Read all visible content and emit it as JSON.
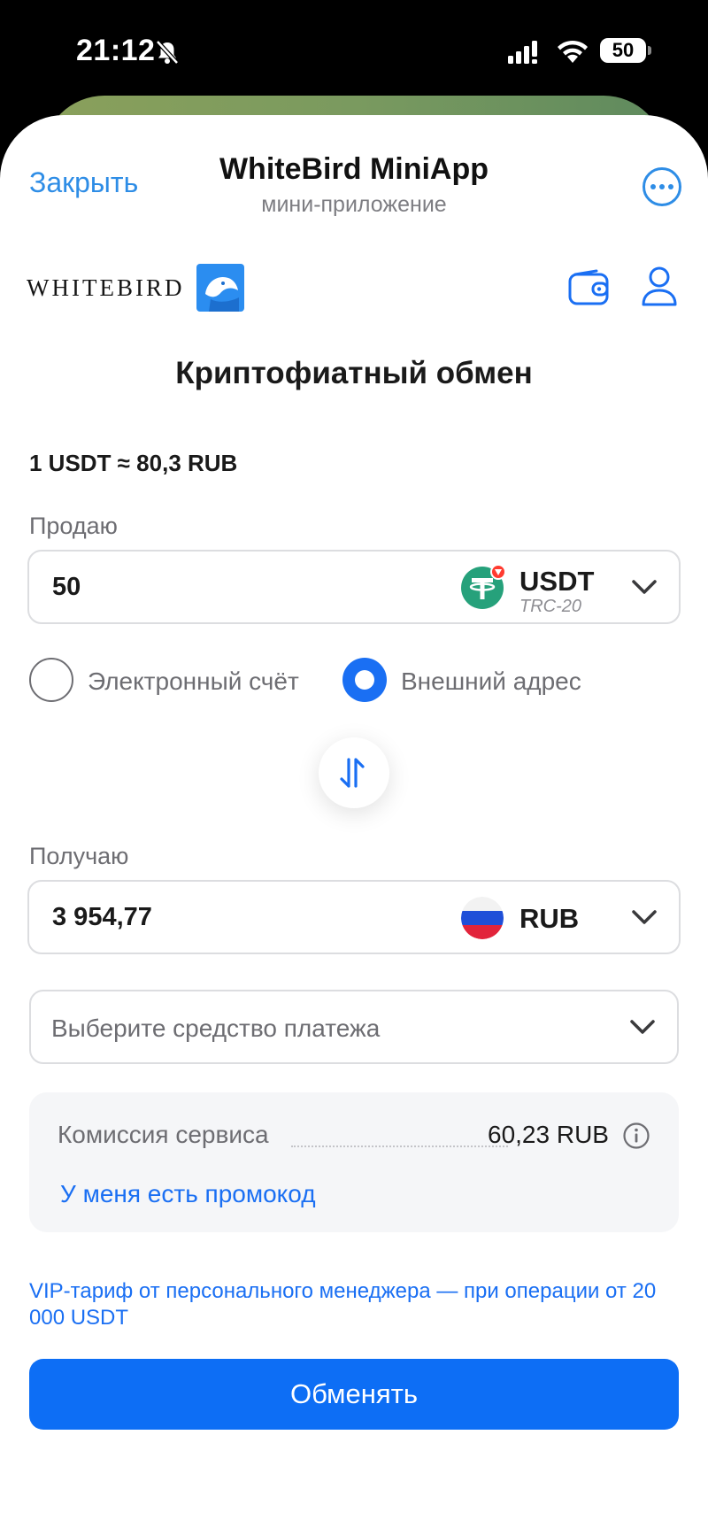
{
  "status_bar": {
    "time": "21:12",
    "battery": "50",
    "icons": [
      "bell-slash-icon",
      "signal-icon",
      "wifi-icon",
      "battery-icon"
    ]
  },
  "header": {
    "close_label": "Закрыть",
    "title": "WhiteBird MiniApp",
    "subtitle": "мини-приложение",
    "more_icon": "more-icon"
  },
  "brand": {
    "wordmark": "WHITEBIRD",
    "icons": [
      "bird-logo-icon",
      "wallet-icon",
      "user-icon"
    ]
  },
  "page": {
    "title": "Криптофиатный обмен",
    "rate": "1 USDT ≈ 80,3 RUB"
  },
  "sell": {
    "label": "Продаю",
    "amount": "50",
    "currency_code": "USDT",
    "network": "TRC-20",
    "icon": "tether-icon"
  },
  "source": {
    "options": [
      {
        "label": "Электронный счёт",
        "selected": false
      },
      {
        "label": "Внешний адрес",
        "selected": true
      }
    ]
  },
  "receive": {
    "label": "Получаю",
    "amount": "3 954,77",
    "currency_code": "RUB",
    "icon": "russia-flag-icon"
  },
  "payment": {
    "placeholder": "Выберите средство платежа"
  },
  "fee": {
    "label": "Комиссия сервиса",
    "value": "60,23 RUB",
    "promo_link": "У меня есть промокод"
  },
  "vip_note": "VIP-тариф от персонального менеджера — при операции от 20 000 USDT",
  "submit_label": "Обменять",
  "colors": {
    "accent": "#1a6ff3",
    "button": "#0d6ef5",
    "telegram_link": "#2e8de6",
    "tether": "#26a17b"
  }
}
